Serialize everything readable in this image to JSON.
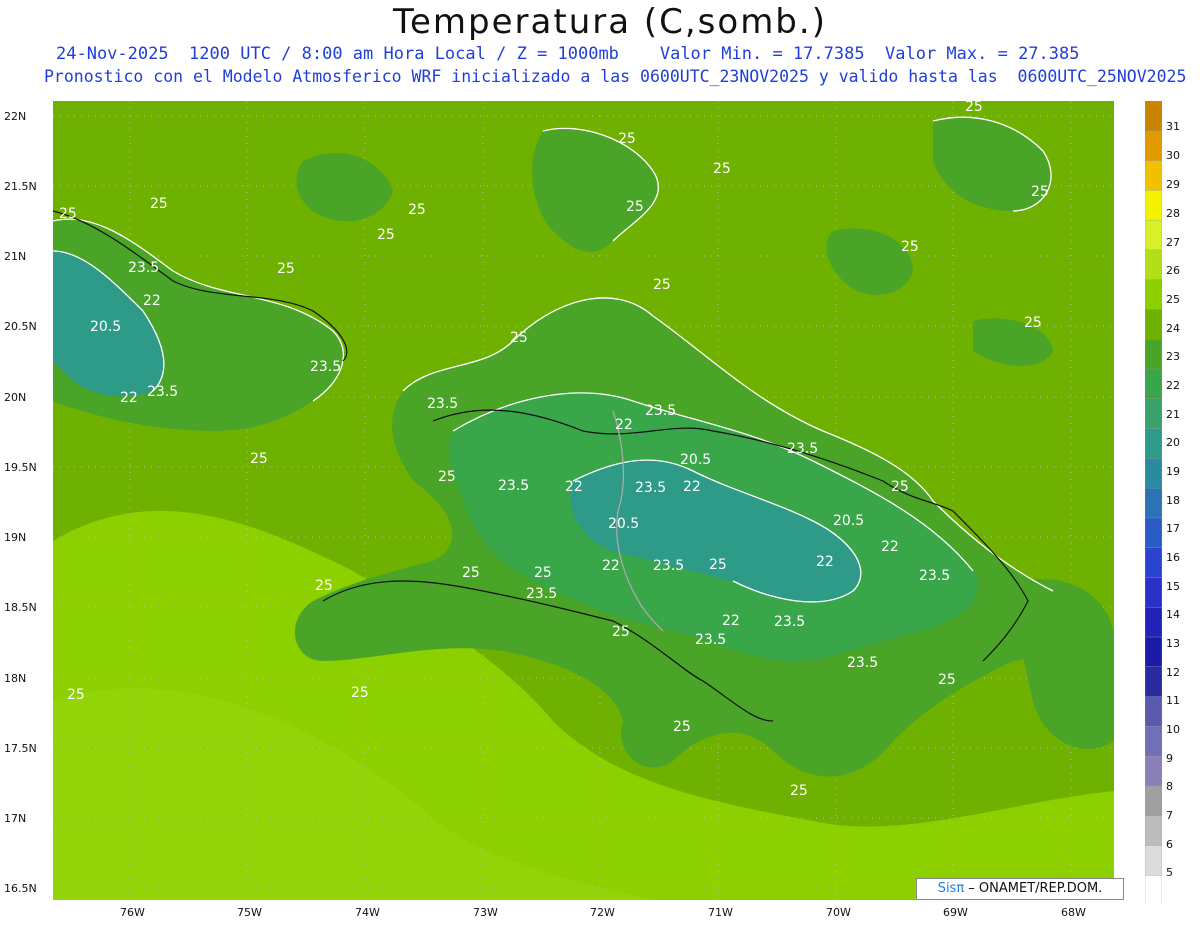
{
  "header": {
    "title": "Temperatura (C,somb.)",
    "line1": "24-Nov-2025  1200 UTC / 8:00 am Hora Local / Z = 1000mb    Valor Min. = 17.7385  Valor Max. = 27.385",
    "line2": "Pronostico con el Modelo Atmosferico WRF inicializado a las 0600UTC_23NOV2025 y valido hasta las  0600UTC_25NOV2025"
  },
  "axes": {
    "lat_labels": [
      "22N",
      "21.5N",
      "21N",
      "20.5N",
      "20N",
      "19.5N",
      "19N",
      "18.5N",
      "18N",
      "17.5N",
      "17N",
      "16.5N"
    ],
    "lon_labels": [
      "76W",
      "75W",
      "74W",
      "73W",
      "72W",
      "71W",
      "70W",
      "69W",
      "68W"
    ]
  },
  "colorbar": {
    "labels": [
      "31",
      "30",
      "29",
      "28",
      "27",
      "26",
      "25",
      "24",
      "23",
      "22",
      "21",
      "20",
      "19",
      "18",
      "17",
      "16",
      "15",
      "14",
      "13",
      "12",
      "11",
      "10",
      "9",
      "8",
      "7",
      "6",
      "5"
    ],
    "colors": [
      "#c98500",
      "#e19a00",
      "#f3c000",
      "#f5f200",
      "#d8f028",
      "#b2e018",
      "#8cd000",
      "#6fb100",
      "#4aa428",
      "#3aa64a",
      "#38a26a",
      "#2e9a88",
      "#2a8aa0",
      "#2a74b4",
      "#2a5cc8",
      "#2a44d0",
      "#2a30c8",
      "#2222b8",
      "#1a1aa8",
      "#2a2aa0",
      "#5a5ab0",
      "#7070b8",
      "#8a80b8",
      "#a0a0a0",
      "#bcbcbc",
      "#dcdcdc",
      "#ffffff"
    ]
  },
  "contour_labels": {
    "l25": "25",
    "l235": "23.5",
    "l22": "22",
    "l205": "20.5"
  },
  "credit": {
    "brand": "Sisπ",
    "text": " – ONAMET/REP.DOM."
  }
}
